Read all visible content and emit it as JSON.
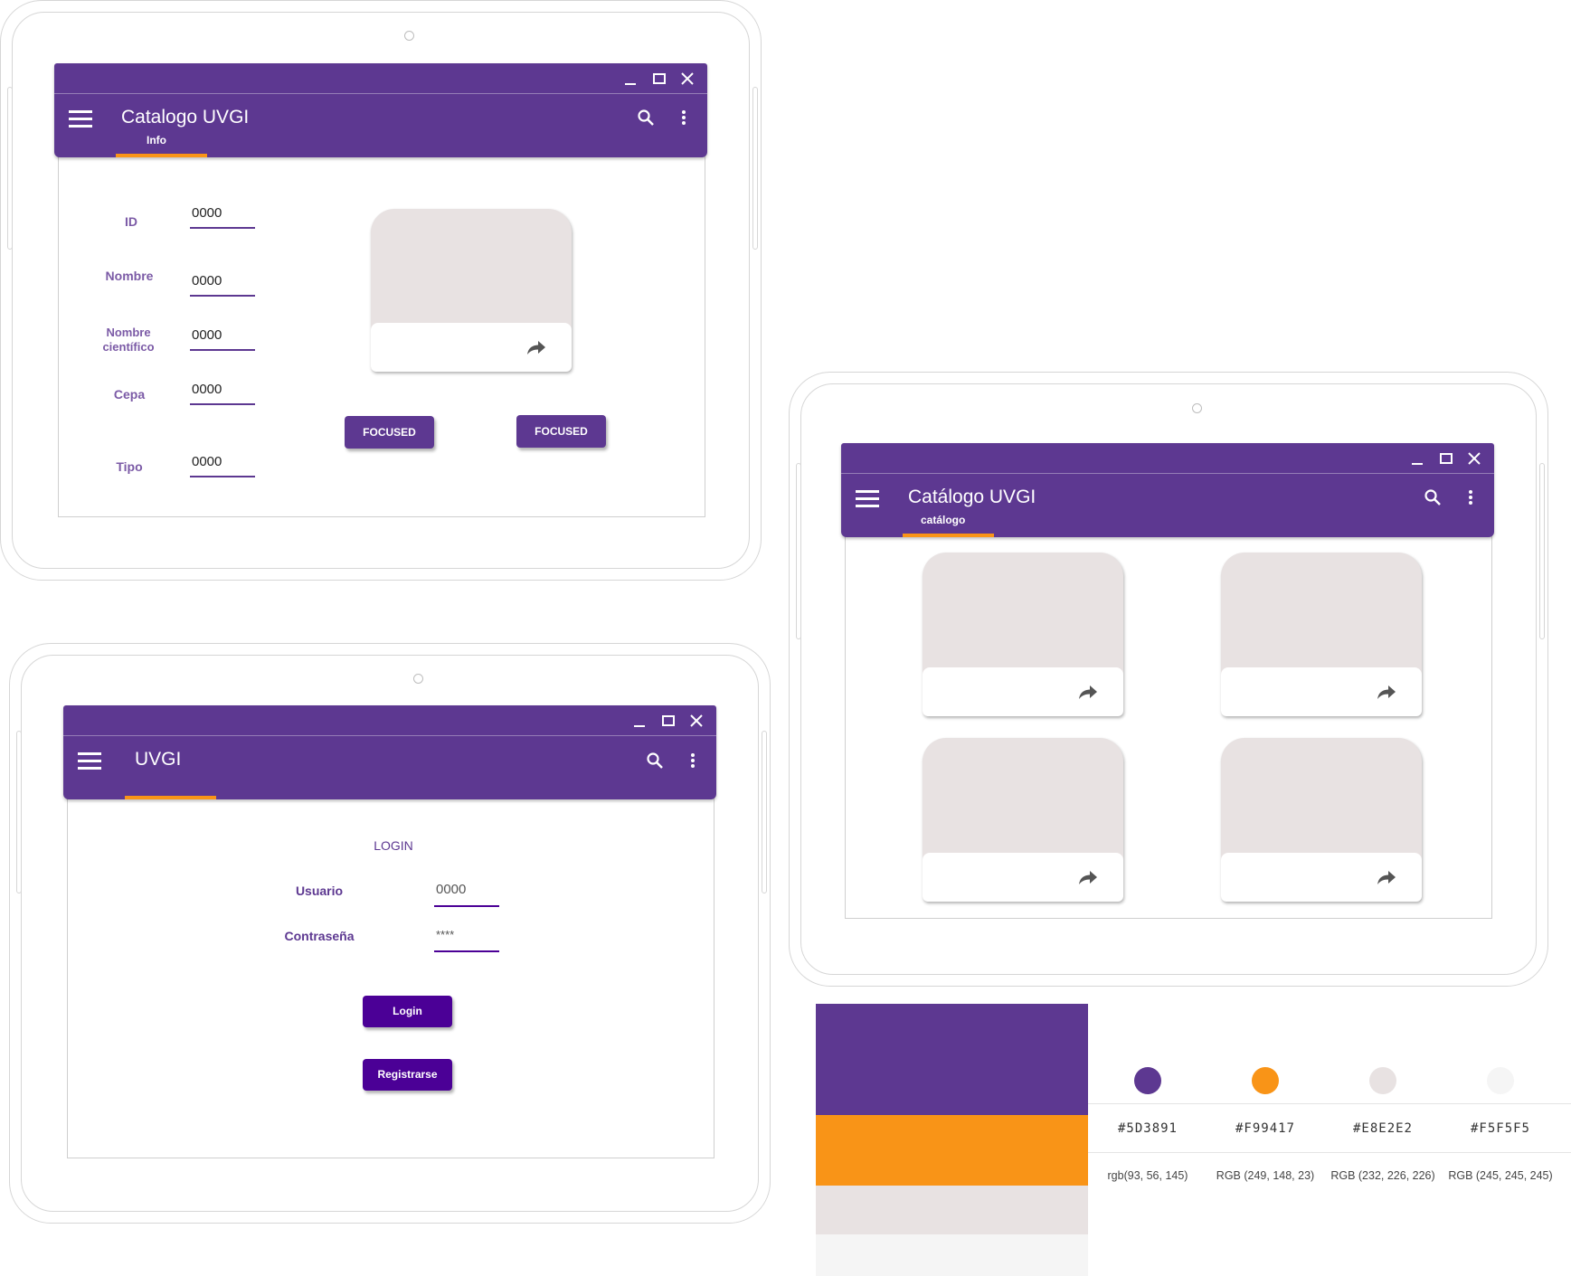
{
  "info_screen": {
    "title": "Catalogo UVGI",
    "tab": "Info",
    "fields": [
      {
        "label": "ID",
        "value": "0000"
      },
      {
        "label": "Nombre",
        "value": "0000"
      },
      {
        "label": "Nombre científico",
        "value": "0000"
      },
      {
        "label": "Cepa",
        "value": "0000"
      },
      {
        "label": "Tipo",
        "value": "0000"
      }
    ],
    "buttons": [
      "FOCUSED",
      "FOCUSED"
    ]
  },
  "login_screen": {
    "title": "UVGI",
    "heading": "LOGIN",
    "user_label": "Usuario",
    "user_value": "0000",
    "password_label": "Contraseña",
    "password_value": "****",
    "login_button": "Login",
    "register_button": "Registrarse"
  },
  "catalog_screen": {
    "title": "Catálogo UVGI",
    "tab": "catálogo"
  },
  "palette": [
    {
      "hex": "#5D3891",
      "rgb": "rgb(93, 56, 145)",
      "color": "#5d3891"
    },
    {
      "hex": "#F99417",
      "rgb": "RGB (249, 148, 23)",
      "color": "#f99417"
    },
    {
      "hex": "#E8E2E2",
      "rgb": "RGB (232, 226, 226)",
      "color": "#e8e2e2"
    },
    {
      "hex": "#F5F5F5",
      "rgb": "RGB (245, 245, 245)",
      "color": "#f5f5f5"
    }
  ],
  "icons": [
    "menu-icon",
    "search-icon",
    "more-vert-icon",
    "minimize-icon",
    "maximize-icon",
    "close-icon",
    "share-icon"
  ]
}
